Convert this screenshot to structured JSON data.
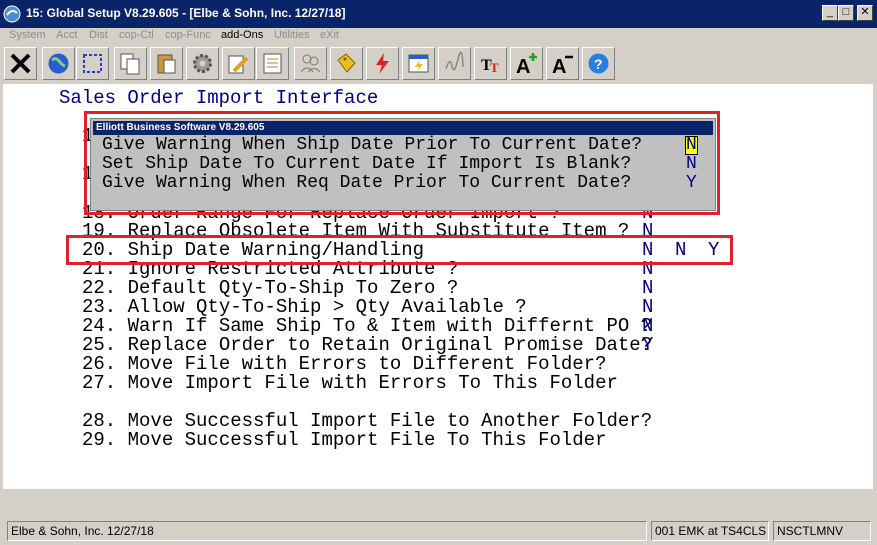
{
  "window": {
    "title": "15: Global Setup V8.29.605 - [Elbe & Sohn, Inc. 12/27/18]",
    "minimize_glyph": "_",
    "maximize_glyph": "□",
    "close_glyph": "✕"
  },
  "menu": [
    "System",
    "Acct",
    "Dist",
    "cop-Ctl",
    "cop-Func",
    "add-Ons",
    "Utilities",
    "eXit"
  ],
  "menu_active_index": 5,
  "toolbar": [
    "exit-x-icon",
    "globe-icon",
    "select-box-icon",
    "copy-icon",
    "paste-icon",
    "settings-gear-icon",
    "edit-pencil-icon",
    "notepad-icon",
    "users-icon",
    "tags-icon",
    "lightning-icon",
    "window-lightning-icon",
    "signature-icon",
    "font-tt-icon",
    "font-increase-icon",
    "font-decrease-icon",
    "help-icon"
  ],
  "screen": {
    "heading": "Sales Order Import Interface",
    "hidden_fragments": {
      "f1": "1",
      "f2": "1",
      "f3": "18. Order Range For Replace Order Import ?",
      "v3": "N"
    },
    "rows": [
      {
        "label": "19. Replace Obsolete Item With Substitute Item ?",
        "values": [
          "N"
        ]
      },
      {
        "label": "20. Ship Date Warning/Handling",
        "values": [
          "N",
          "N",
          "Y"
        ]
      },
      {
        "label": "21. Ignore Restricted Attribute ?",
        "values": [
          "N"
        ]
      },
      {
        "label": "22. Default Qty-To-Ship To Zero ?",
        "values": [
          "N"
        ]
      },
      {
        "label": "23. Allow Qty-To-Ship > Qty Available ?",
        "values": [
          "N"
        ]
      },
      {
        "label": "24. Warn If Same Ship To & Item with Differnt PO ?",
        "values": [
          "N"
        ]
      },
      {
        "label": "25. Replace Order to Retain Original Promise Date?",
        "values": [
          "Y"
        ]
      },
      {
        "label": "26. Move File with Errors to Different Folder?",
        "values": []
      },
      {
        "label": "27. Move Import File with Errors To This Folder",
        "values": []
      },
      {
        "label": "28. Move Successful Import File to Another Folder?",
        "values": []
      },
      {
        "label": "29. Move Successful Import File To This Folder",
        "values": []
      }
    ]
  },
  "dialog": {
    "title": "Elliott Business Software V8.29.605",
    "rows": [
      {
        "label": "Give Warning When Ship Date Prior To Current Date?",
        "value": "N"
      },
      {
        "label": "Set Ship Date To Current Date If Import Is Blank?",
        "value": "N"
      },
      {
        "label": "Give Warning When Req Date Prior To Current Date?",
        "value": "Y"
      }
    ]
  },
  "status": {
    "company": "Elbe & Sohn, Inc. 12/27/18",
    "user": "001 EMK at TS4CLS",
    "program": "NSCTLMNV"
  },
  "colors": {
    "title_bar": "#0a246a",
    "value_text": "#000080",
    "highlight_border": "#e0202a",
    "cursor_bg": "#ffff00"
  }
}
